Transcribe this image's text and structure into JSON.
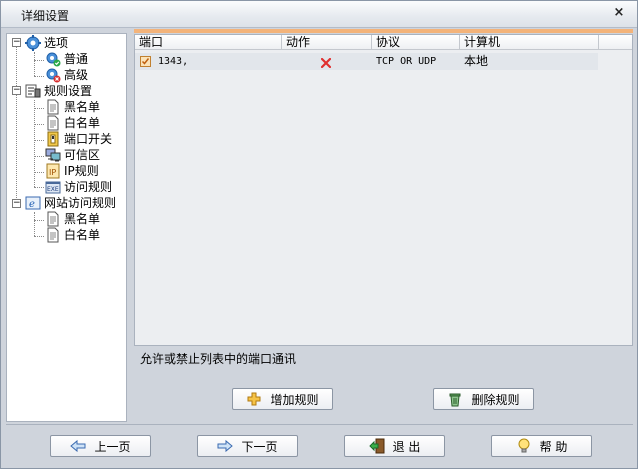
{
  "window": {
    "title": "详细设置",
    "close_glyph": "×"
  },
  "tree": {
    "groups": [
      {
        "label": "选项",
        "icon": "gear-options-icon",
        "expander": "−",
        "children": [
          {
            "label": "普通",
            "icon": "gear-green-icon"
          },
          {
            "label": "高级",
            "icon": "gear-red-icon"
          }
        ]
      },
      {
        "label": "规则设置",
        "icon": "rules-icon",
        "expander": "−",
        "children": [
          {
            "label": "黑名单",
            "icon": "document-icon"
          },
          {
            "label": "白名单",
            "icon": "document-icon"
          },
          {
            "label": "端口开关",
            "icon": "port-switch-icon"
          },
          {
            "label": "可信区",
            "icon": "network-computer-icon"
          },
          {
            "label": "IP规则",
            "icon": "ip-icon"
          },
          {
            "label": "访问规则",
            "icon": "exe-icon"
          }
        ]
      },
      {
        "label": "网站访问规则",
        "icon": "ie-web-icon",
        "expander": "−",
        "children": [
          {
            "label": "黑名单",
            "icon": "document-icon"
          },
          {
            "label": "白名单",
            "icon": "document-icon"
          }
        ]
      }
    ]
  },
  "table": {
    "columns": [
      "端口",
      "动作",
      "协议",
      "计算机"
    ],
    "rows": [
      {
        "checked": true,
        "port": "1343,",
        "action": "deny",
        "protocol": "TCP OR UDP",
        "computer": "本地"
      }
    ]
  },
  "description": "允许或禁止列表中的端口通讯",
  "buttons": {
    "add_rule": "增加规则",
    "delete_rule": "删除规则"
  },
  "footer": {
    "prev": "上一页",
    "next": "下一页",
    "exit": "退 出",
    "help": "帮 助"
  },
  "colors": {
    "accent_orange": "#f3b37a",
    "deny_red": "#e03030"
  }
}
